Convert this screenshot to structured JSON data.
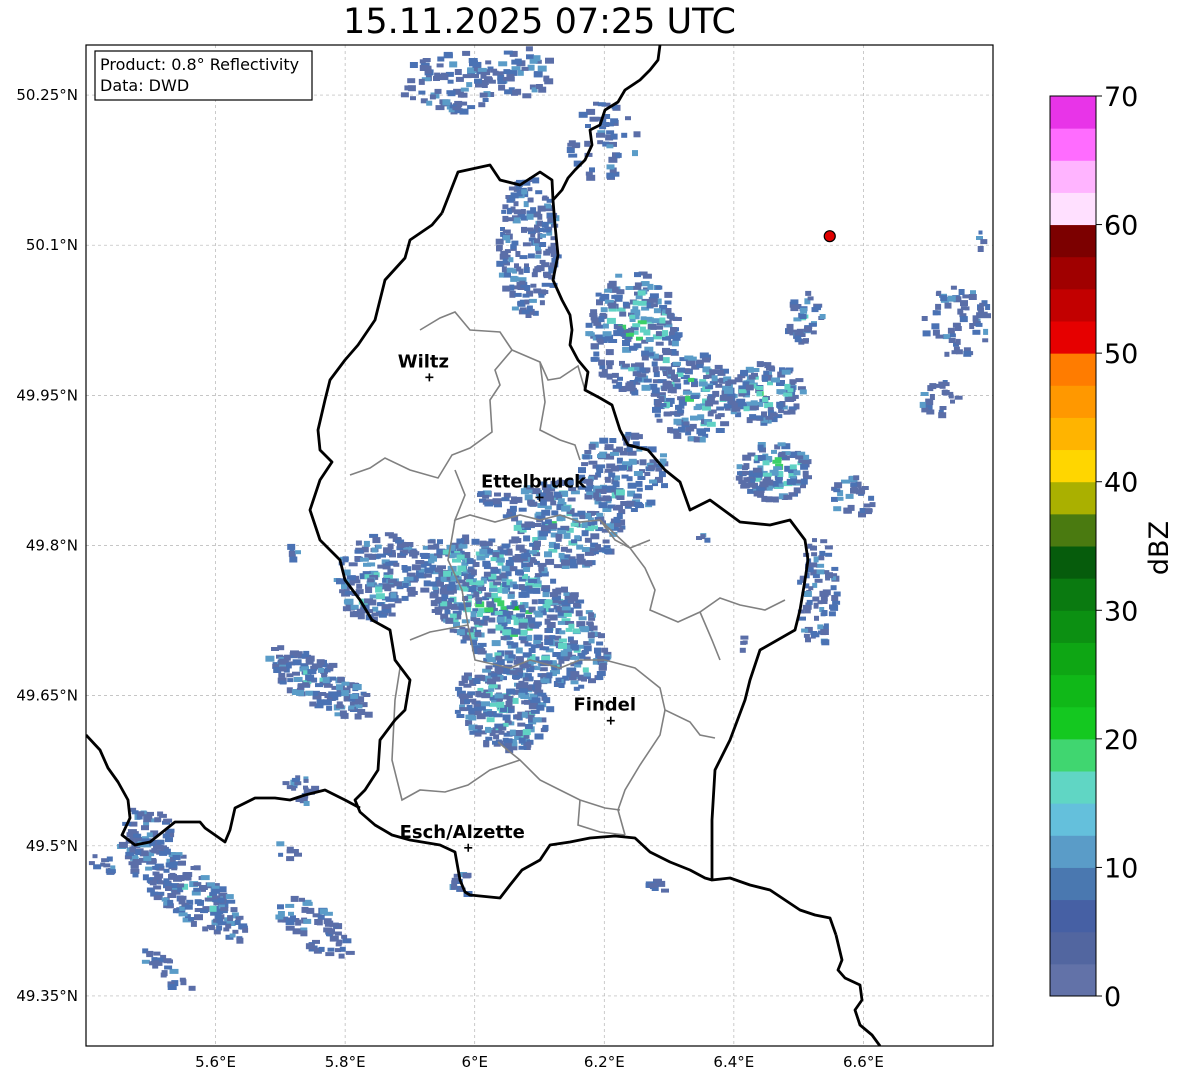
{
  "title": "15.11.2025 07:25 UTC",
  "info": {
    "product": "Product: 0.8° Reflectivity",
    "data_source": "Data: DWD"
  },
  "axes": {
    "lon_ticks": [
      {
        "value": 5.6,
        "label": "5.6°E"
      },
      {
        "value": 5.8,
        "label": "5.8°E"
      },
      {
        "value": 6.0,
        "label": "6°E"
      },
      {
        "value": 6.2,
        "label": "6.2°E"
      },
      {
        "value": 6.4,
        "label": "6.4°E"
      },
      {
        "value": 6.6,
        "label": "6.6°E"
      }
    ],
    "lat_ticks": [
      {
        "value": 50.25,
        "label": "50.25°N"
      },
      {
        "value": 50.1,
        "label": "50.1°N"
      },
      {
        "value": 49.95,
        "label": "49.95°N"
      },
      {
        "value": 49.8,
        "label": "49.8°N"
      },
      {
        "value": 49.65,
        "label": "49.65°N"
      },
      {
        "value": 49.5,
        "label": "49.5°N"
      },
      {
        "value": 49.35,
        "label": "49.35°N"
      }
    ],
    "lon_range": [
      5.4,
      6.8
    ],
    "lat_range": [
      49.3,
      50.3
    ],
    "grid": true
  },
  "cities": [
    {
      "name": "Wiltz",
      "lon": 5.93,
      "lat": 49.968
    },
    {
      "name": "Ettelbruck",
      "lon": 6.1,
      "lat": 49.848
    },
    {
      "name": "Findel",
      "lon": 6.21,
      "lat": 49.625
    },
    {
      "name": "Esch/Alzette",
      "lon": 5.99,
      "lat": 49.498
    }
  ],
  "radar_marker": {
    "lon": 6.548,
    "lat": 50.109,
    "color": "#e00000"
  },
  "colorbar": {
    "label": "dBZ",
    "ticks": [
      "0",
      "10",
      "20",
      "30",
      "40",
      "50",
      "60",
      "70"
    ],
    "colors": [
      "#6272a8",
      "#5266a0",
      "#4660a4",
      "#4a78b0",
      "#5a9cc8",
      "#64c0dc",
      "#60d6c4",
      "#40d670",
      "#14c820",
      "#10b818",
      "#0ea614",
      "#0c9012",
      "#0a7a10",
      "#065c0c",
      "#4a7a10",
      "#aab000",
      "#ffd600",
      "#ffb400",
      "#ff9800",
      "#ff7c00",
      "#e60000",
      "#c20000",
      "#a00000",
      "#7c0000",
      "#ffe0ff",
      "#ffb4ff",
      "#ff6cff",
      "#e834e8"
    ]
  },
  "echo_colors": {
    "weak": "#5a6ea8",
    "light": "#4a72b4",
    "moderate": "#5a9cc8",
    "medium": "#60d2c4",
    "strong": "#3cd068",
    "heavy": "#14c020"
  }
}
